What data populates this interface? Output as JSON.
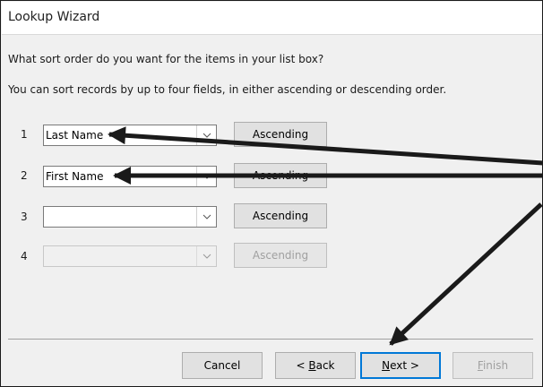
{
  "window": {
    "title": "Lookup Wizard"
  },
  "prompt": {
    "question": "What sort order do you want for the items in your list box?",
    "instruction": "You can sort records by up to four fields, in either ascending or descending order."
  },
  "sort_rows": [
    {
      "number": "1",
      "field": "Last Name",
      "order": "Ascending",
      "enabled": true
    },
    {
      "number": "2",
      "field": "First Name",
      "order": "Ascending",
      "enabled": true
    },
    {
      "number": "3",
      "field": "",
      "order": "Ascending",
      "enabled": true
    },
    {
      "number": "4",
      "field": "",
      "order": "Ascending",
      "enabled": false
    }
  ],
  "buttons": {
    "cancel": "Cancel",
    "back_prefix": "< ",
    "back_mnemonic": "B",
    "back_rest": "ack",
    "next_mnemonic": "N",
    "next_rest": "ext >",
    "finish_mnemonic": "F",
    "finish_rest": "inish"
  },
  "colors": {
    "annotation_arrow": "#1a1a1a",
    "default_button_border": "#0078d7"
  }
}
